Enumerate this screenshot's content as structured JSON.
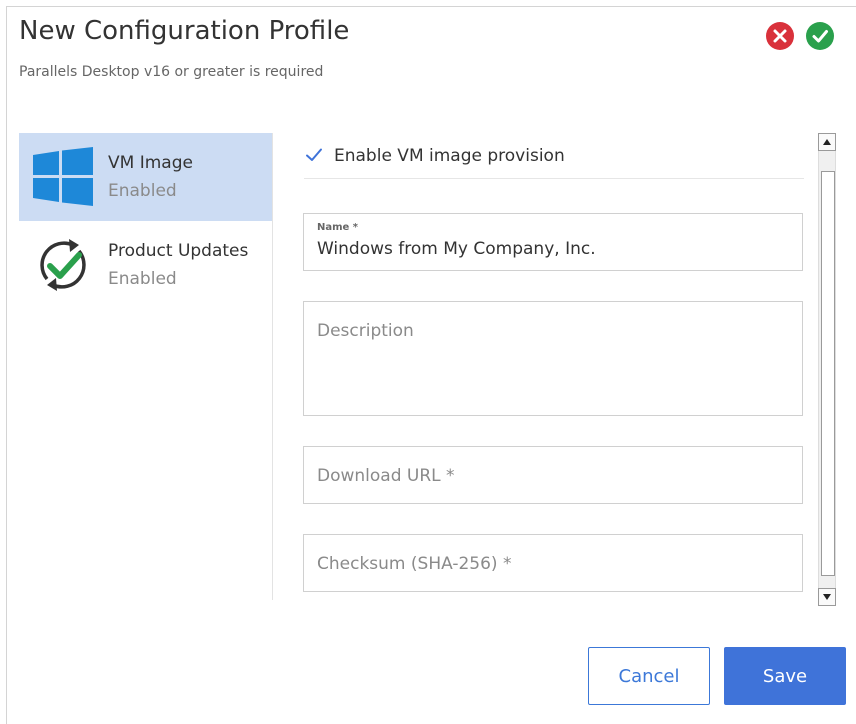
{
  "dialog": {
    "title": "New Configuration Profile",
    "subtitle": "Parallels Desktop v16 or greater is required"
  },
  "sidebar": {
    "items": [
      {
        "label": "VM Image",
        "status": "Enabled",
        "icon": "windows-logo-icon",
        "active": true
      },
      {
        "label": "Product Updates",
        "status": "Enabled",
        "icon": "update-check-icon",
        "active": false
      }
    ]
  },
  "form": {
    "enable_label": "Enable VM image provision",
    "enable_checked": true,
    "name": {
      "label": "Name *",
      "value": "Windows from My Company, Inc."
    },
    "description": {
      "placeholder": "Description"
    },
    "download_url": {
      "placeholder": "Download URL *"
    },
    "checksum": {
      "placeholder": "Checksum (SHA-256) *"
    }
  },
  "footer": {
    "cancel_label": "Cancel",
    "save_label": "Save"
  },
  "colors": {
    "primary": "#3f73d9",
    "close": "#d9313b",
    "ok": "#2aa04c",
    "active_item": "#ccdcf3"
  }
}
